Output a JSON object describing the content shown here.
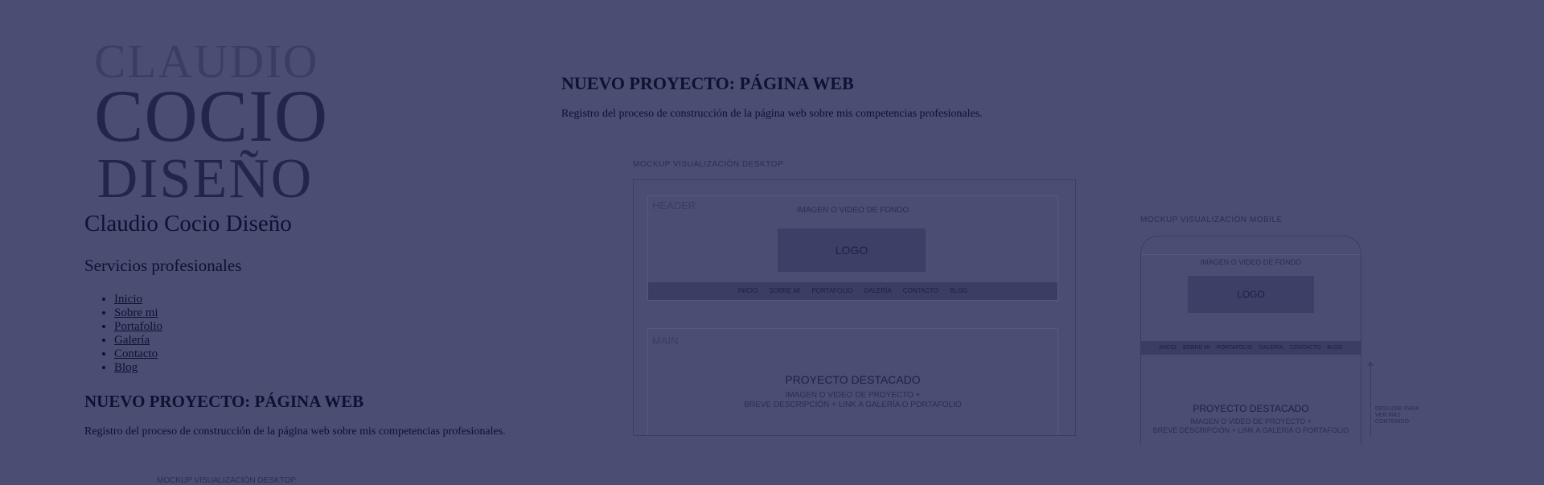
{
  "logo": {
    "line1": "CLAUDIO",
    "line2": "COCIO",
    "line3": "DISEÑO"
  },
  "site": {
    "title": "Claudio Cocio Diseño",
    "subtitle": "Servicios profesionales"
  },
  "nav": [
    "Inicio",
    "Sobre mi",
    "Portafolio",
    "Galería",
    "Contacto",
    "Blog"
  ],
  "article": {
    "heading": "NUEVO PROYECTO: PÁGINA WEB",
    "paragraph": "Registro del proceso de construcción de la página web sobre mis competencias profesionales.",
    "caption_left": "MOCKUP VISUALIZACIÓN DESKTOP"
  },
  "mockup_desktop": {
    "caption": "MOCKUP VISUALIZACIÓN DESKTOP",
    "header_label": "HEADER",
    "bg_text": "IMAGEN O VIDEO DE FONDO",
    "logo": "LOGO",
    "nav": [
      "INICIO",
      "SOBRE MI",
      "PORTAFOLIO",
      "GALERÍA",
      "CONTACTO",
      "BLOG"
    ],
    "main_label": "MAIN",
    "featured": "PROYECTO DESTACADO",
    "desc1": "IMAGEN O VIDEO DE PROYECTO +",
    "desc2": "BREVE DESCRIPCIÓN + LINK A GALERÍA O PORTAFOLIO"
  },
  "mockup_mobile": {
    "caption": "MOCKUP VISUALIZACIÓN MOBILE",
    "bg_text": "IMAGEN O VIDEO DE FONDO",
    "logo": "LOGO",
    "nav": [
      "INICIO",
      "SOBRE MI",
      "PORTAFOLIO",
      "GALERÍA",
      "CONTACTO",
      "BLOG"
    ],
    "featured": "PROYECTO DESTACADO",
    "desc1": "IMAGEN O VIDEO DE PROYECTO +",
    "desc2": "BREVE DESCRIPCIÓN + LINK A GALERÍA O PORTAFOLIO",
    "scroll_note": "DESLIZAR PARA VER MÁS CONTENIDO"
  }
}
